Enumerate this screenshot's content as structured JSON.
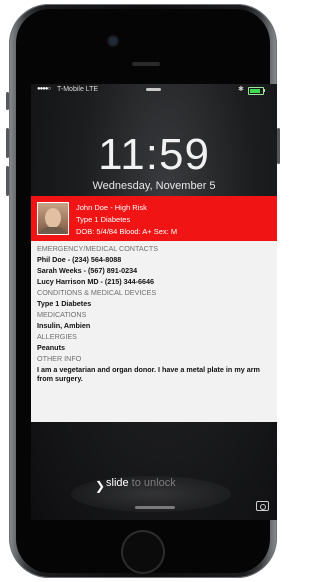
{
  "status": {
    "signal": "●●●●○",
    "carrier": "T-Mobile  LTE",
    "bluetooth": "✱"
  },
  "clock": {
    "time": "11:59",
    "date": "Wednesday, November 5"
  },
  "alert": {
    "name_line": "John Doe - High Risk",
    "condition_line": "Type 1 Diabetes",
    "vitals_line": "DOB: 5/4/84 Blood: A+ Sex: M"
  },
  "info": {
    "emergency_label": "EMERGENCY/MEDICAL CONTACTS",
    "contacts": [
      "Phil Doe - (234) 564-8088",
      "Sarah Weeks - (567) 891-0234",
      "Lucy Harrison MD - (215) 344-6646"
    ],
    "conditions_label": "CONDITIONS & MEDICAL DEVICES",
    "conditions_value": "Type 1 Diabetes",
    "medications_label": "MEDICATIONS",
    "medications_value": "Insulin, Ambien",
    "allergies_label": "ALLERGIES",
    "allergies_value": "Peanuts",
    "other_label": "OTHER INFO",
    "other_value": "I am a vegetarian and organ donor. I have a metal plate in my arm from surgery."
  },
  "unlock": {
    "chevron": "❯",
    "word": "slide",
    "rest": " to unlock"
  },
  "icons": [
    "lock-icon",
    "bluetooth-icon",
    "battery-icon",
    "camera-icon"
  ]
}
